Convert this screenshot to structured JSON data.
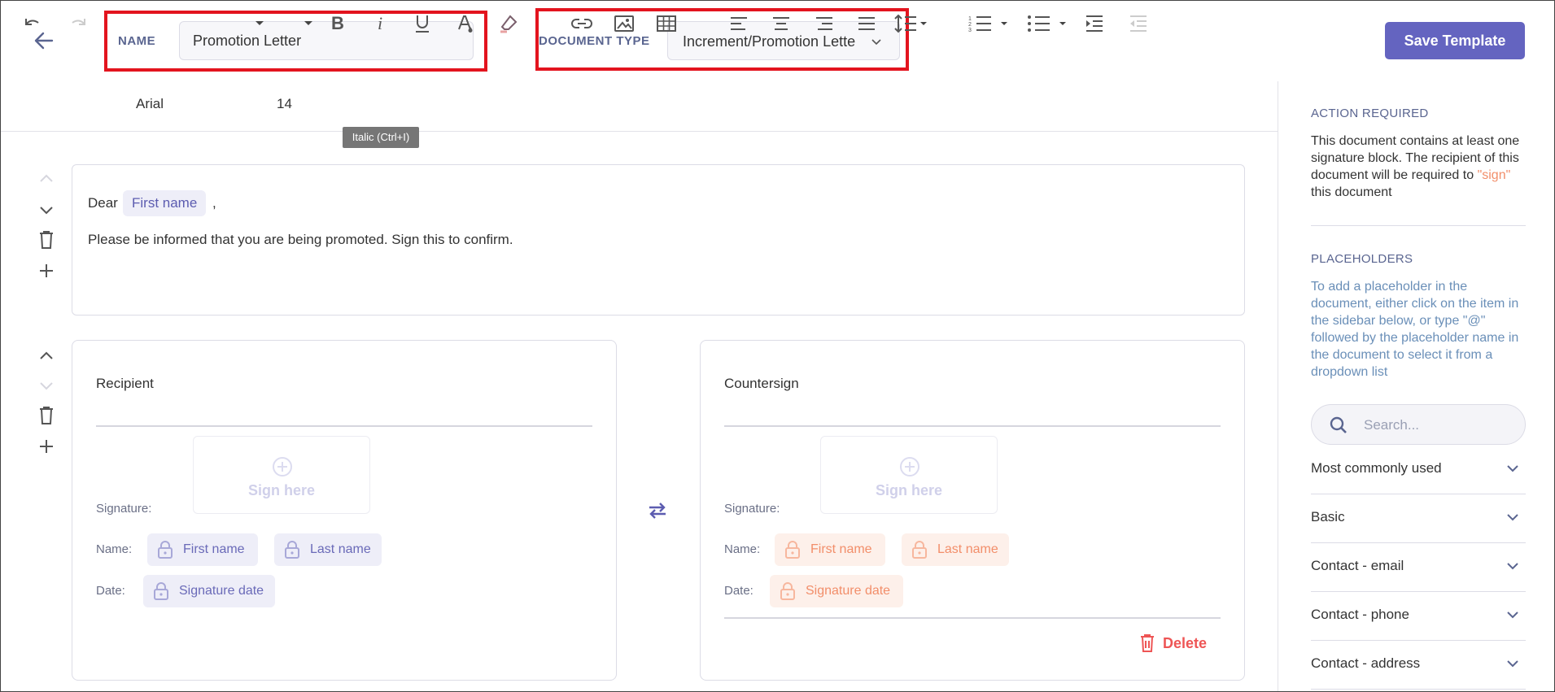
{
  "header": {
    "name_label": "NAME",
    "name_value": "Promotion Letter",
    "doc_type_label": "DOCUMENT TYPE",
    "doc_type_value": "Increment/Promotion Letter",
    "save_label": "Save Template"
  },
  "toolbar": {
    "font_family": "Arial",
    "font_size": "14",
    "tooltip": "Italic (Ctrl+I)",
    "buttons": [
      "undo-icon",
      "redo-icon",
      "bold-icon",
      "italic-icon",
      "underline-icon",
      "text-color-icon",
      "highlight-icon",
      "link-icon",
      "image-icon",
      "table-icon",
      "align-left-icon",
      "align-center-icon",
      "align-right-icon",
      "align-justify-icon",
      "line-height-icon",
      "numbered-list-icon",
      "bullet-list-icon",
      "indent-icon",
      "outdent-icon"
    ]
  },
  "letter": {
    "greeting": "Dear",
    "greeting_placeholder": "First name",
    "greeting_suffix": ",",
    "body": "Please be informed that you are being promoted. Sign this to confirm."
  },
  "recipient": {
    "title": "Recipient",
    "sign_here": "Sign here",
    "signature_label": "Signature:",
    "name_label": "Name:",
    "date_label": "Date:",
    "first_name": "First name",
    "last_name": "Last name",
    "signature_date": "Signature date"
  },
  "countersign": {
    "title": "Countersign",
    "sign_here": "Sign here",
    "signature_label": "Signature:",
    "name_label": "Name:",
    "date_label": "Date:",
    "first_name": "First name",
    "last_name": "Last name",
    "signature_date": "Signature date",
    "delete_label": "Delete"
  },
  "sidebar": {
    "action_heading": "ACTION REQUIRED",
    "action_text_1": "This document contains at least one signature block. The recipient of this document will be required to",
    "action_sign": "\"sign\"",
    "action_text_2": "this document",
    "placeholders_heading": "PLACEHOLDERS",
    "placeholders_text": "To add a placeholder in the document, either click on the item in the sidebar below, or type \"@\" followed by the placeholder name in the document to select it from a dropdown list",
    "search_placeholder": "Search...",
    "groups": [
      "Most commonly used",
      "Basic",
      "Contact - email",
      "Contact - phone",
      "Contact - address"
    ]
  },
  "colors": {
    "accent": "#6464c0",
    "highlight_border": "#e3141e",
    "recipient_chip": "#eeeef8",
    "countersign_chip": "#fdf0ea",
    "delete": "#ee5555",
    "sign_word": "#f28e6a"
  }
}
